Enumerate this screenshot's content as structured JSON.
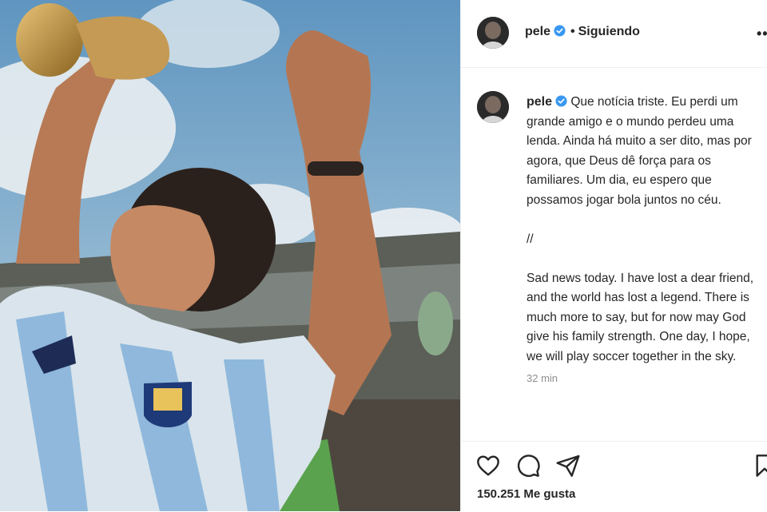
{
  "post": {
    "username": "pele",
    "separator": "•",
    "follow_status": "Siguiendo",
    "more_label": "•••",
    "caption_username": "pele",
    "caption_text": "Que notícia triste. Eu perdi um grande amigo e o mundo perdeu uma lenda. Ainda há muito a ser dito, mas por agora, que Deus dê força para os familiares. Um dia, eu espero que possamos jogar bola juntos no céu.\n\n//\n\nSad news today. I have lost a dear friend, and the world has lost a legend. There is much more to say, but for now may God give his family strength. One day, I hope, we will play soccer together in the sky.",
    "timestamp": "32 min",
    "likes": "150.251 Me gusta"
  },
  "icons": {
    "verified": "verified-badge-icon",
    "like": "heart-icon",
    "comment": "comment-bubble-icon",
    "share": "paper-plane-icon",
    "save": "bookmark-icon"
  },
  "colors": {
    "verified_blue": "#3897f0",
    "text": "#262626",
    "secondary": "#8e8e8e",
    "border": "#efefef"
  }
}
